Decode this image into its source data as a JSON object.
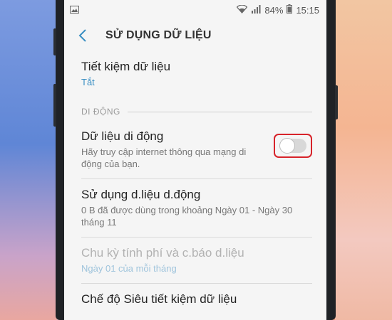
{
  "status": {
    "battery": "84%",
    "time": "15:15"
  },
  "appbar": {
    "title": "SỬ DỤNG DỮ LIỆU"
  },
  "data_saver": {
    "title": "Tiết kiệm dữ liệu",
    "value": "Tắt"
  },
  "section": {
    "label": "DI ĐỘNG"
  },
  "mobile_data": {
    "title": "Dữ liệu di động",
    "subtitle_line1": "Hãy truy cập internet thông qua mạng di",
    "subtitle_line2": "động của bạn.",
    "toggle_on": false
  },
  "mobile_usage": {
    "title": "Sử dụng d.liệu d.động",
    "subtitle_line1": "0 B đã được dùng trong khoảng Ngày 01 - Ngày 30",
    "subtitle_line2": "tháng 11"
  },
  "billing_cycle": {
    "title": "Chu kỳ tính phí và c.báo d.liệu",
    "subtitle": "Ngày 01 của mỗi tháng"
  },
  "ultra_saver": {
    "title": "Chế độ Siêu tiết kiệm dữ liệu"
  },
  "colors": {
    "accent": "#3a8fc3",
    "highlight": "#d7232a"
  }
}
